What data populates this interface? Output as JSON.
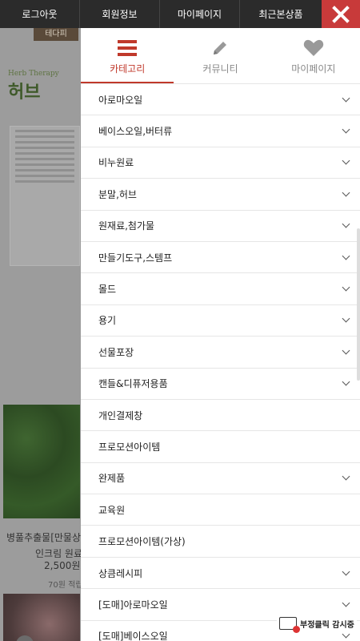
{
  "topbar": {
    "items": [
      "로그아웃",
      "회원정보",
      "마이페이지",
      "최근본상품"
    ],
    "close_icon": "close-x-icon",
    "close_color": "#c83a3a"
  },
  "background": {
    "logo": "테다피",
    "brand": "허브",
    "brand_small": "Herb Therapy",
    "product_name_line1": "병풀추출물[만물상",
    "product_name_line2": "인크림 원료",
    "price": "2,500원",
    "points": "70원 적립"
  },
  "tabs": [
    {
      "label": "카테고리",
      "icon": "menu-icon",
      "active": true
    },
    {
      "label": "커뮤니티",
      "icon": "pencil-icon",
      "active": false
    },
    {
      "label": "마이페이지",
      "icon": "heart-icon",
      "active": false
    }
  ],
  "menu": [
    {
      "label": "아로마오일",
      "chevron": true
    },
    {
      "label": "베이스오일,버터류",
      "chevron": true
    },
    {
      "label": "비누원료",
      "chevron": true
    },
    {
      "label": "분말,허브",
      "chevron": true
    },
    {
      "label": "원재료,첨가물",
      "chevron": true
    },
    {
      "label": "만들기도구,스템프",
      "chevron": true
    },
    {
      "label": "몰드",
      "chevron": true
    },
    {
      "label": "용기",
      "chevron": true
    },
    {
      "label": "선물포장",
      "chevron": true
    },
    {
      "label": "캔들&디퓨저용품",
      "chevron": true
    },
    {
      "label": "개인결제창",
      "chevron": false
    },
    {
      "label": "프로모션아이템",
      "chevron": false
    },
    {
      "label": "완제품",
      "chevron": true
    },
    {
      "label": "교육원",
      "chevron": false
    },
    {
      "label": "프로모션아이템(가상)",
      "chevron": false
    },
    {
      "label": "상큼레시피",
      "chevron": true
    },
    {
      "label": "[도매]아로마오일",
      "chevron": true
    },
    {
      "label": "[도매]베이스오일",
      "chevron": true
    }
  ],
  "fraud_badge": "부정클릭 감시중",
  "accent_color": "#c0392b"
}
